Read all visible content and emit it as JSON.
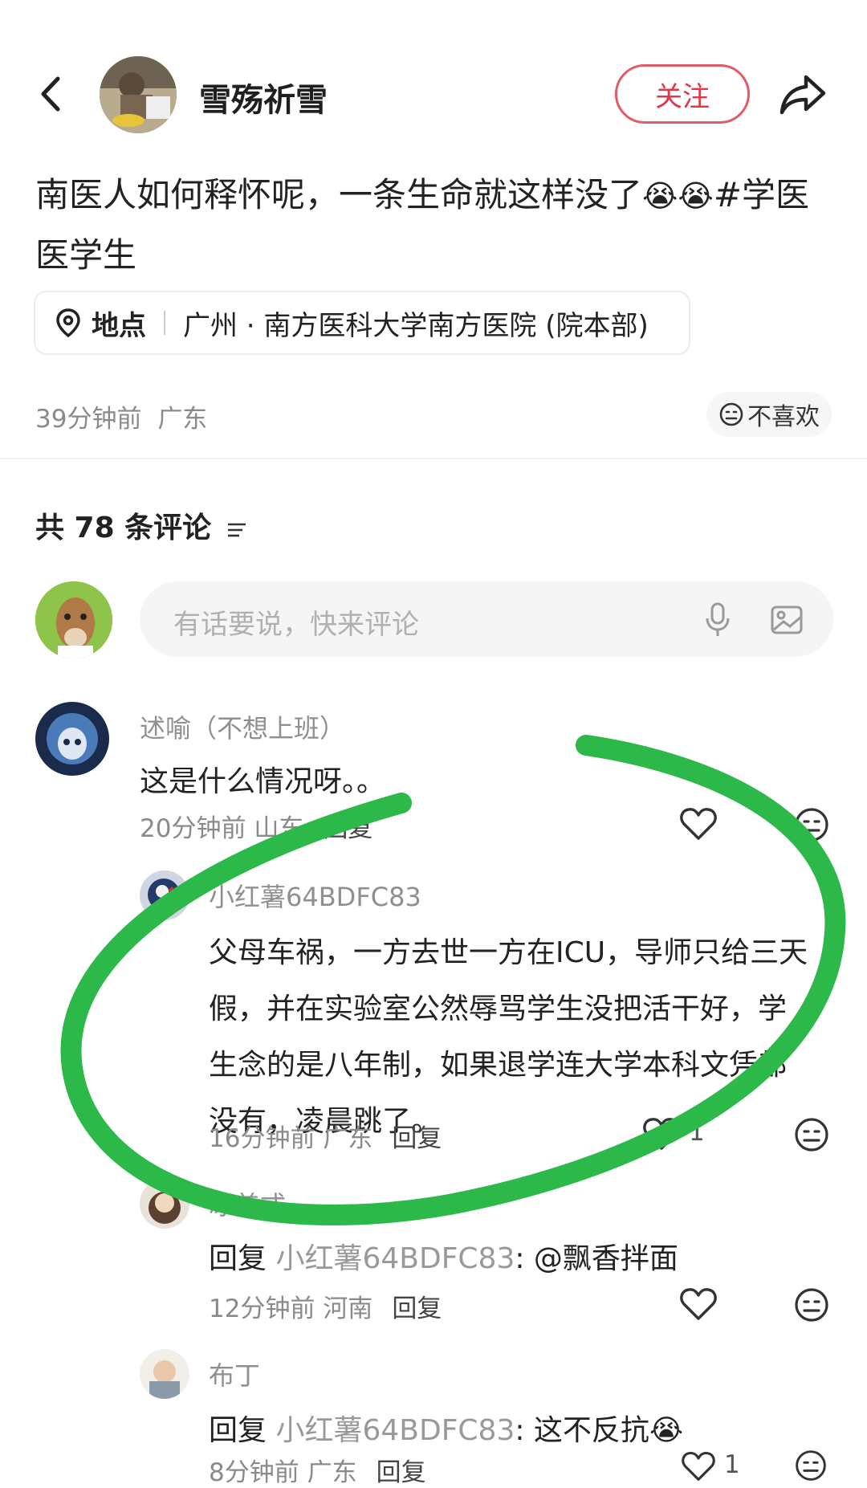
{
  "header": {
    "username": "雪殇祈雪",
    "follow_label": "关注"
  },
  "post": {
    "text": "南医人如何释怀呢，一条生命就这样没了",
    "emojis": "😭😭",
    "tag": "#学医",
    "text_line2": "医学生",
    "location_label": "地点",
    "location_value": "广州 · 南方医科大学南方医院 (院本部)",
    "time": "39分钟前",
    "region": "广东",
    "dislike_label": "不喜欢"
  },
  "comments_section": {
    "count_label": "共 78 条评论",
    "input_placeholder": "有话要说，快来评论"
  },
  "comments": [
    {
      "user": "述喻（不想上班）",
      "text": "这是什么情况呀。。",
      "time": "20分钟前",
      "region": "山东",
      "reply": "回复"
    },
    {
      "user": "小红薯64BDFC83",
      "lines": [
        "父母车祸，一方去世一方在ICU，导师只给三天",
        "假，并在实验室公然辱骂学生没把活干好，学",
        "生念的是八年制，如果退学连大学本科文凭都",
        "没有，凌晨跳了。"
      ],
      "time": "16分钟前",
      "region": "广东",
      "reply": "回复",
      "likes": "1"
    },
    {
      "user": "冰美式",
      "reply_prefix": "回复",
      "reply_to": "小红薯64BDFC83",
      "text": ": @飘香拌面",
      "time": "12分钟前",
      "region": "河南",
      "reply": "回复"
    },
    {
      "user": "布丁",
      "reply_prefix": "回复",
      "reply_to": "小红薯64BDFC83",
      "text": ": 这不反抗",
      "emoji": "😭",
      "time": "8分钟前",
      "region": "广东",
      "reply": "回复",
      "likes": "1"
    }
  ],
  "colors": {
    "accent": "#e03848",
    "annotation": "#2db84a"
  }
}
